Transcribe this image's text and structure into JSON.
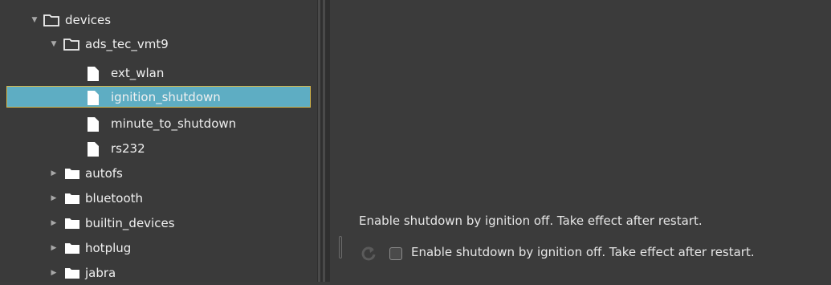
{
  "tree": {
    "nodes": [
      {
        "label": "devices",
        "type": "folder",
        "expanded": true
      },
      {
        "label": "ads_tec_vmt9",
        "type": "folder",
        "expanded": true
      },
      {
        "label": "ext_wlan",
        "type": "file"
      },
      {
        "label": "ignition_shutdown",
        "type": "file",
        "selected": true
      },
      {
        "label": "minute_to_shutdown",
        "type": "file"
      },
      {
        "label": "rs232",
        "type": "file"
      },
      {
        "label": "autofs",
        "type": "folder",
        "expanded": false
      },
      {
        "label": "bluetooth",
        "type": "folder",
        "expanded": false
      },
      {
        "label": "builtin_devices",
        "type": "folder",
        "expanded": false
      },
      {
        "label": "hotplug",
        "type": "folder",
        "expanded": false
      },
      {
        "label": "jabra",
        "type": "folder",
        "expanded": false
      }
    ]
  },
  "detail": {
    "description": "Enable shutdown by ignition off. Take effect after restart.",
    "checkbox_label": "Enable shutdown by ignition off. Take effect after restart.",
    "checked": false,
    "reset_icon": "reset-icon"
  },
  "colors": {
    "background": "#3b3b3b",
    "selection": "#5eadc3",
    "selection_border": "#d8b84a"
  }
}
